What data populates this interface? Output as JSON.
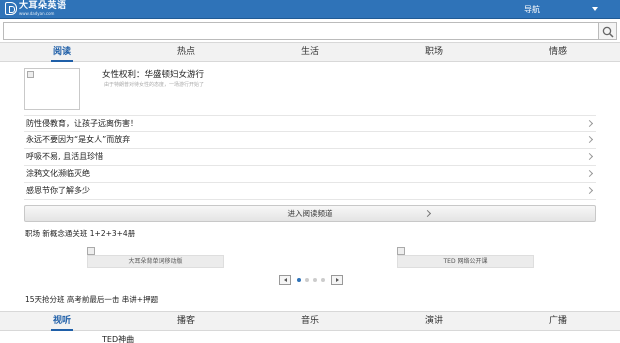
{
  "header": {
    "logo_title": "大耳朵英语",
    "logo_url": "www.dadyan.com",
    "nav_label": "导航"
  },
  "search": {
    "value": "",
    "placeholder": ""
  },
  "top_tabs": [
    {
      "label": "阅读",
      "active": true
    },
    {
      "label": "热点",
      "active": false
    },
    {
      "label": "生活",
      "active": false
    },
    {
      "label": "职场",
      "active": false
    },
    {
      "label": "情感",
      "active": false
    }
  ],
  "feature": {
    "title": "女性权利：华盛顿妇女游行",
    "subtitle": "由于特朗普对待女性的态度，一场游行开始了"
  },
  "articles": [
    {
      "label": "防性侵教育，让孩子远离伤害！"
    },
    {
      "label": "永远不要因为“是女人”而放弃"
    },
    {
      "label": "呼吸不易, 且活且珍惜"
    },
    {
      "label": "涂鸦文化濒临灭绝"
    },
    {
      "label": "感恩节你了解多少"
    }
  ],
  "enter_button": "进入阅读频道",
  "promo_line_1": "职场 新概念通关班 1+2+3+4册",
  "carousel": {
    "items": [
      {
        "caption": "大耳朵背单词移动版"
      },
      {
        "caption": "TED 网络公开课"
      }
    ],
    "dot_count": 4,
    "active_dot": 0
  },
  "promo_line_2": "15天抢分班 高考前最后一击 串讲+押题",
  "bottom_tabs": [
    {
      "label": "视听",
      "active": true
    },
    {
      "label": "播客",
      "active": false
    },
    {
      "label": "音乐",
      "active": false
    },
    {
      "label": "演讲",
      "active": false
    },
    {
      "label": "广播",
      "active": false
    }
  ],
  "bottom_peek": "TED神曲",
  "colors": {
    "brand": "#2f73b8",
    "active_tab": "#1f5fa8",
    "tab_bar": "#f2f2f2"
  }
}
